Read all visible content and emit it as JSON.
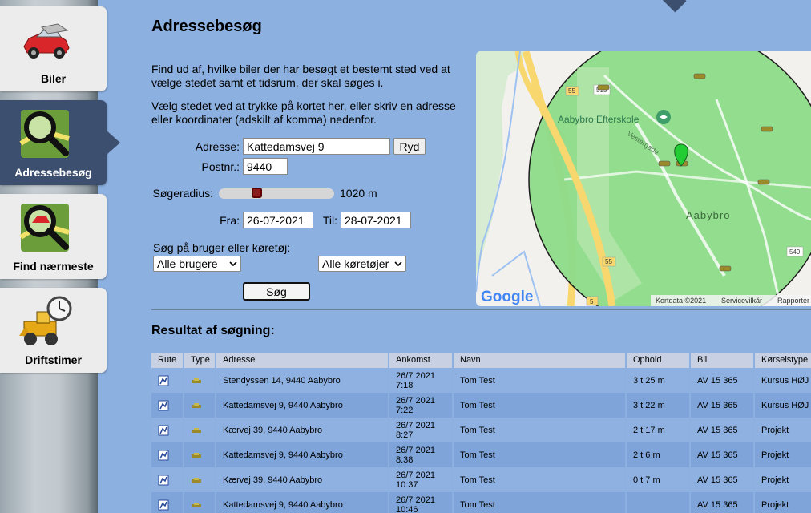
{
  "nav": {
    "items": [
      {
        "label": "Biler",
        "icon": "car-icon"
      },
      {
        "label": "Adressebesøg",
        "icon": "magnifier-map-icon"
      },
      {
        "label": "Find nærmeste",
        "icon": "magnifier-car-icon"
      },
      {
        "label": "Driftstimer",
        "icon": "loader-clock-icon"
      }
    ],
    "active_index": 1
  },
  "page": {
    "title": "Adressebesøg",
    "intro1": "Find ud af, hvilke biler der har besøgt et bestemt sted ved at vælge stedet samt et tidsrum, der skal søges i.",
    "intro2": "Vælg stedet ved at trykke på kortet her, eller skriv en adresse eller koordinater (adskilt af komma) nedenfor."
  },
  "form": {
    "address_label": "Adresse:",
    "address_value": "Kattedamsvej 9",
    "clear_label": "Ryd",
    "zip_label": "Postnr.:",
    "zip_value": "9440",
    "radius_label": "Søgeradius:",
    "radius_value_text": "1020 m",
    "radius_fraction": 0.24,
    "from_label": "Fra:",
    "from_value": "26-07-2021",
    "to_label": "Til:",
    "to_value": "28-07-2021",
    "filter_label": "Søg på bruger eller køretøj:",
    "user_select": "Alle brugere",
    "vehicle_select": "Alle køretøjer",
    "search_label": "Søg"
  },
  "map": {
    "labels": {
      "school": "Aabybro Efterskole",
      "street": "Vestergade",
      "town": "Aabybro",
      "road515": "515",
      "road55a": "55",
      "road55b": "55",
      "road549": "549",
      "road5": "5"
    },
    "logo": "Google",
    "footer": {
      "data": "Kortdata ©2021",
      "terms": "Servicevilkår",
      "report": "Rapporter"
    },
    "colors": {
      "radius_fill": "#8edc8a",
      "marker": "#22cc33"
    }
  },
  "results": {
    "title": "Resultat af søgning:",
    "columns": [
      "Rute",
      "Type",
      "Adresse",
      "Ankomst",
      "Navn",
      "Ophold",
      "Bil",
      "Kørselstype"
    ],
    "rows": [
      {
        "address": "Stendyssen 14, 9440 Aabybro",
        "arrival_date": "26/7 2021",
        "arrival_time": "7:18",
        "name": "Tom Test",
        "stay": "3 t 25 m",
        "car": "AV 15 365",
        "type": "Kursus HØJ"
      },
      {
        "address": "Kattedamsvej 9, 9440 Aabybro",
        "arrival_date": "26/7 2021",
        "arrival_time": "7:22",
        "name": "Tom Test",
        "stay": "3 t 22 m",
        "car": "AV 15 365",
        "type": "Kursus HØJ"
      },
      {
        "address": "Kærvej 39, 9440 Aabybro",
        "arrival_date": "26/7 2021",
        "arrival_time": "8:27",
        "name": "Tom Test",
        "stay": "2 t 17 m",
        "car": "AV 15 365",
        "type": "Projekt"
      },
      {
        "address": "Kattedamsvej 9, 9440 Aabybro",
        "arrival_date": "26/7 2021",
        "arrival_time": "8:38",
        "name": "Tom Test",
        "stay": "2 t 6 m",
        "car": "AV 15 365",
        "type": "Projekt"
      },
      {
        "address": "Kærvej 39, 9440 Aabybro",
        "arrival_date": "26/7 2021",
        "arrival_time": "10:37",
        "name": "Tom Test",
        "stay": "0 t 7 m",
        "car": "AV 15 365",
        "type": "Projekt"
      },
      {
        "address": "Kattedamsvej 9, 9440 Aabybro",
        "arrival_date": "26/7 2021",
        "arrival_time": "10:46",
        "name": "Tom Test",
        "stay": "",
        "car": "AV 15 365",
        "type": "Projekt"
      }
    ]
  }
}
